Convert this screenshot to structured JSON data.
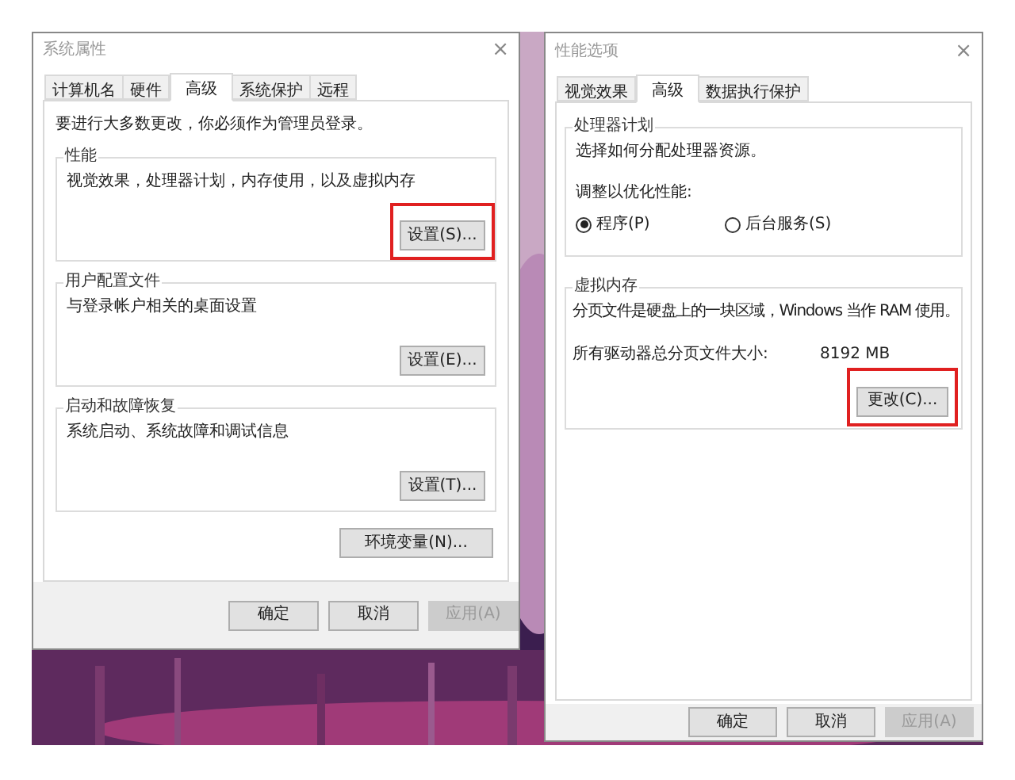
{
  "system_properties": {
    "title": "系统属性",
    "close": "×",
    "tabs": [
      {
        "label": "计算机名",
        "selected": false
      },
      {
        "label": "硬件",
        "selected": false
      },
      {
        "label": "高级",
        "selected": true
      },
      {
        "label": "系统保护",
        "selected": false
      },
      {
        "label": "远程",
        "selected": false
      }
    ],
    "notice": "要进行大多数更改，你必须作为管理员登录。",
    "groups": [
      {
        "title": "性能",
        "description": "视觉效果，处理器计划，内存使用，以及虚拟内存",
        "button": {
          "label": "设置(S)...",
          "highlighted": true
        }
      },
      {
        "title": "用户配置文件",
        "description": "与登录帐户相关的桌面设置",
        "button": {
          "label": "设置(E)...",
          "highlighted": false
        }
      },
      {
        "title": "启动和故障恢复",
        "description": "系统启动、系统故障和调试信息",
        "button": {
          "label": "设置(T)...",
          "highlighted": false
        }
      }
    ],
    "env_button": "环境变量(N)...",
    "buttons": [
      {
        "label": "确定",
        "disabled": false
      },
      {
        "label": "取消",
        "disabled": false
      },
      {
        "label": "应用(A)",
        "disabled": true
      }
    ]
  },
  "performance_options": {
    "title": "性能选项",
    "close": "×",
    "tabs": [
      {
        "label": "视觉效果",
        "selected": false
      },
      {
        "label": "高级",
        "selected": true
      },
      {
        "label": "数据执行保护",
        "selected": false
      }
    ],
    "processor_group": {
      "title": "处理器计划",
      "description": "选择如何分配处理器资源。",
      "prompt": "调整以优化性能:",
      "options": [
        {
          "label": "程序(P)",
          "selected": true
        },
        {
          "label": "后台服务(S)",
          "selected": false
        }
      ]
    },
    "memory_group": {
      "title": "虚拟内存",
      "description": "分页文件是硬盘上的一块区域，Windows 当作 RAM 使用。",
      "size_label": "所有驱动器总分页文件大小:",
      "size_value": "8192 MB",
      "button": {
        "label": "更改(C)...",
        "highlighted": true
      }
    },
    "buttons": [
      {
        "label": "确定",
        "disabled": false
      },
      {
        "label": "取消",
        "disabled": false
      },
      {
        "label": "应用(A)",
        "disabled": true
      }
    ]
  }
}
